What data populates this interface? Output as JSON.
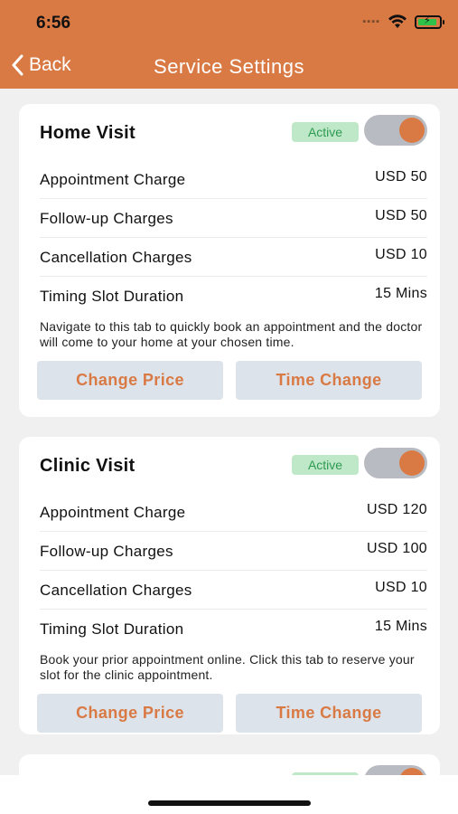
{
  "status": {
    "time": "6:56"
  },
  "nav": {
    "back_label": "Back",
    "title": "Service Settings"
  },
  "cards": [
    {
      "title": "Home Visit",
      "status": "Active",
      "toggle_on": true,
      "rows": [
        {
          "label": "Appointment Charge",
          "value": "USD 50"
        },
        {
          "label": "Follow-up Charges",
          "value": "USD 50"
        },
        {
          "label": "Cancellation Charges",
          "value": "USD 10"
        },
        {
          "label": "Timing Slot Duration",
          "value": "15 Mins"
        }
      ],
      "description": "Navigate to this tab to quickly book an appointment and the doctor will come to your home at your chosen time.",
      "buttons": {
        "change_price": "Change Price",
        "time_change": "Time Change"
      }
    },
    {
      "title": "Clinic Visit",
      "status": "Active",
      "toggle_on": true,
      "rows": [
        {
          "label": "Appointment Charge",
          "value": "USD 120"
        },
        {
          "label": "Follow-up Charges",
          "value": "USD 100"
        },
        {
          "label": "Cancellation Charges",
          "value": "USD 10"
        },
        {
          "label": "Timing Slot Duration",
          "value": "15 Mins"
        }
      ],
      "description": "Book your prior appointment online. Click this tab to reserve your slot for the clinic appointment.",
      "buttons": {
        "change_price": "Change Price",
        "time_change": "Time Change"
      }
    }
  ],
  "colors": {
    "accent": "#d97a45",
    "badge_bg": "#bfe8c8",
    "badge_text": "#2e9a52",
    "button_bg": "#dde3ea"
  },
  "icons": [
    "wifi-icon",
    "battery-icon",
    "chevron-left-icon"
  ]
}
